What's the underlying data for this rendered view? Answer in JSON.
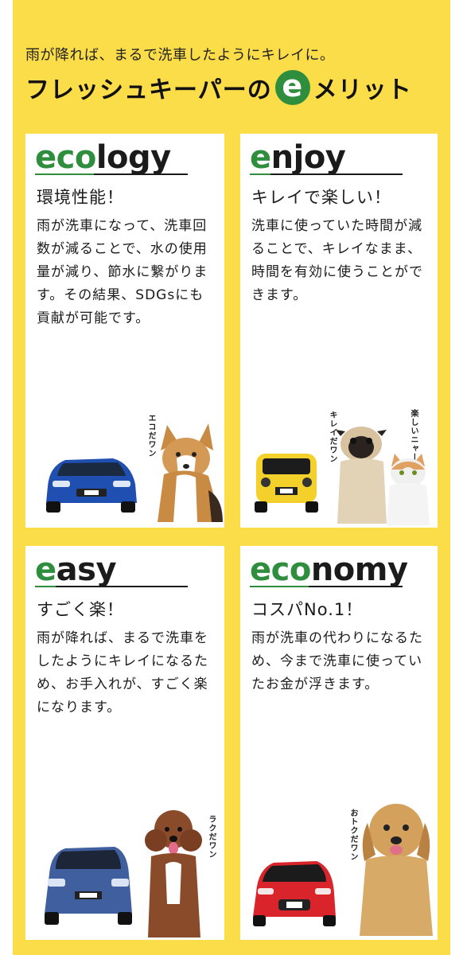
{
  "header": {
    "subtitle": "雨が降れば、まるで洗車したようにキレイに。",
    "headline_before": "フレッシュキーパーの",
    "badge_letter": "e",
    "headline_after": "メリット"
  },
  "cards": [
    {
      "title_green": "eco",
      "title_rest": "logy",
      "heading": "環境性能！",
      "body": "雨が洗車になって、洗車回数が減ることで、水の使用量が減り、節水に繋がります。その結果、SDGsにも貢献が可能です。",
      "label1": "エコだワン",
      "car_color": "#1f4fb0",
      "pet": "corgi"
    },
    {
      "title_green": "e",
      "title_rest": "njoy",
      "heading": "キレイで楽しい！",
      "body": "洗車に使っていた時間が減ることで、キレイなまま、時間を有効に使うことができます。",
      "label1": "キレイだワン",
      "label2": "楽しいニャー",
      "car_color": "#f3d12a",
      "pet": "pug-cat"
    },
    {
      "title_green": "e",
      "title_rest": "asy",
      "heading": "すごく楽！",
      "body": "雨が降れば、まるで洗車をしたようにキレイになるため、お手入れが、すごく楽になります。",
      "label1": "ラクだワン",
      "car_color": "#3f5f9e",
      "pet": "poodle"
    },
    {
      "title_green": "eco",
      "title_rest": "nomy",
      "heading": "コスパNo.1！",
      "body": "雨が洗車の代わりになるため、今まで洗車に使っていたお金が浮きます。",
      "label1": "おトクだワン",
      "car_color": "#d9242b",
      "pet": "golden"
    }
  ],
  "colors": {
    "background": "#fbdc49",
    "accent_green": "#2e8e3e"
  }
}
